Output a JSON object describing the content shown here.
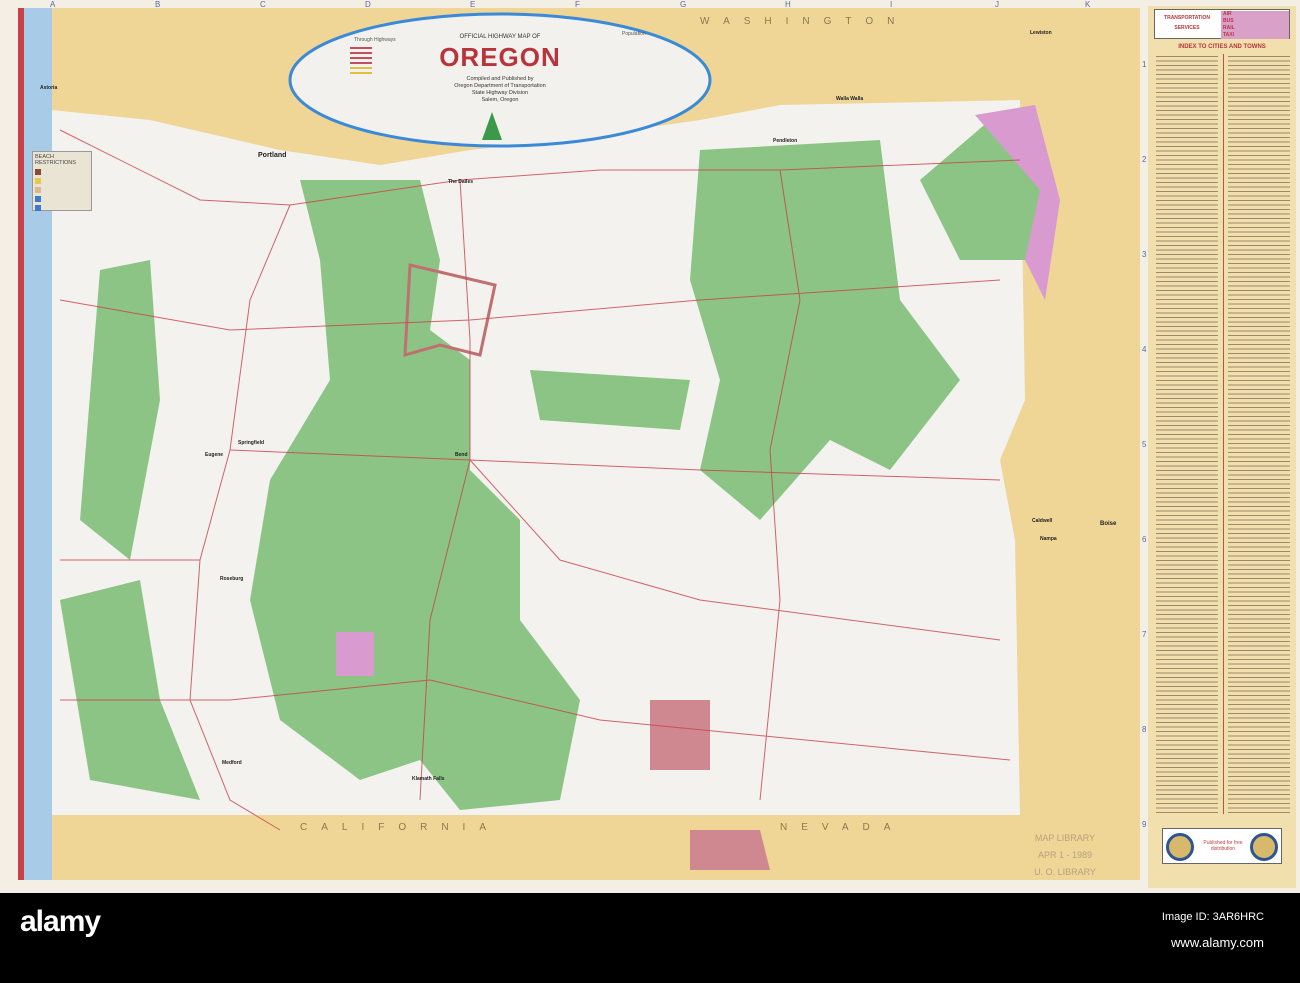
{
  "title": {
    "small": "OFFICIAL HIGHWAY MAP OF",
    "main": "OREGON",
    "compiled": [
      "Compiled and Published by",
      "Oregon Department of Transportation",
      "State Highway Division",
      "Salem, Oregon"
    ]
  },
  "legend": {
    "population": "Population",
    "through_highways": "Through Highways"
  },
  "grid_letters": [
    "A",
    "B",
    "C",
    "D",
    "E",
    "F",
    "G",
    "H",
    "I",
    "J",
    "K"
  ],
  "row_numbers": [
    "1",
    "2",
    "3",
    "4",
    "5",
    "6",
    "7",
    "8",
    "9"
  ],
  "states": {
    "washington": "WASHINGTON",
    "nevada": "NEVADA",
    "california": "CALIFORNIA"
  },
  "cities": {
    "portland": "Portland",
    "the_dalles": "The Dalles",
    "pendleton": "Pendleton",
    "walla_walla": "Walla Walla",
    "lewiston": "Lewiston",
    "astoria": "Astoria",
    "eugene": "Eugene",
    "springfield": "Springfield",
    "bend": "Bend",
    "roseburg": "Roseburg",
    "medford": "Medford",
    "klamath_falls": "Klamath Falls",
    "boise": "Boise",
    "caldwell": "Caldwell",
    "nampa": "Nampa"
  },
  "beach": {
    "title": "BEACH RESTRICTIONS",
    "colors": [
      "#8a4a3a",
      "#e8c84a",
      "#d8b890",
      "#3a7ad0",
      "#3a7ad0"
    ]
  },
  "stamp": {
    "line1": "MAP LIBRARY",
    "line2": "APR 1 - 1989",
    "line3": "U. O. LIBRARY"
  },
  "index": {
    "transport_logo": [
      "TRANSPORTATION",
      "SERVICES"
    ],
    "modes": [
      "AIR",
      "BUS",
      "RAIL",
      "TAXI"
    ],
    "title": "INDEX TO CITIES AND TOWNS",
    "published": "Published for free distribution"
  },
  "watermark": {
    "brand": "alamy",
    "image_id": "Image ID: 3AR6HRC",
    "url": "www.alamy.com"
  },
  "colors": {
    "forest": "#8cc485",
    "land": "#f3f2ee",
    "neighbor": "#efd596",
    "ocean": "#a8cce8",
    "roads": "#c8404a",
    "oval": "#3a8ad8"
  }
}
